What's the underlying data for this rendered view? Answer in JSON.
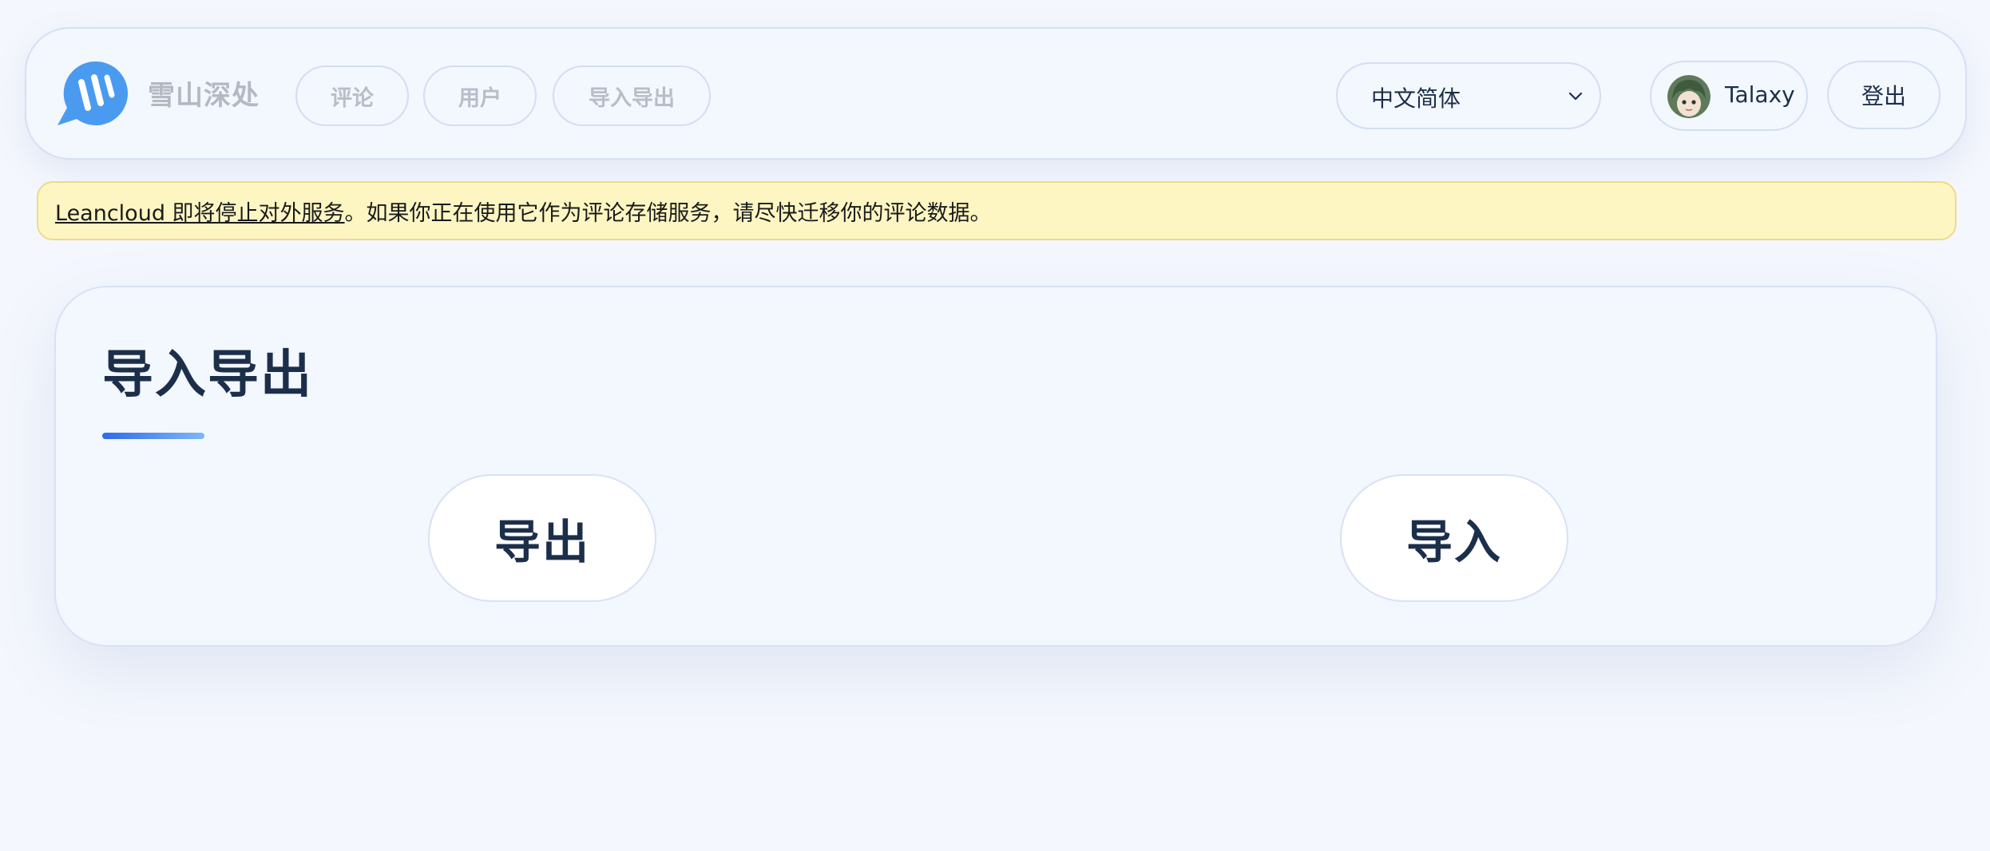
{
  "header": {
    "site_name": "雪山深处",
    "nav": {
      "comments": "评论",
      "users": "用户",
      "import_export": "导入导出"
    },
    "language": {
      "selected": "中文简体"
    },
    "user": {
      "name": "Talaxy"
    },
    "logout_label": "登出"
  },
  "notice": {
    "link_text": "Leancloud 即将停止对外服务",
    "message": "。如果你正在使用它作为评论存储服务，请尽快迁移你的评论数据。"
  },
  "main": {
    "title": "导入导出",
    "export_label": "导出",
    "import_label": "导入"
  },
  "colors": {
    "accent": "#2f6be8",
    "logo_blue": "#4a9bf0",
    "notice_bg": "#fdf6c3",
    "text_dark": "#1c2f4a"
  }
}
